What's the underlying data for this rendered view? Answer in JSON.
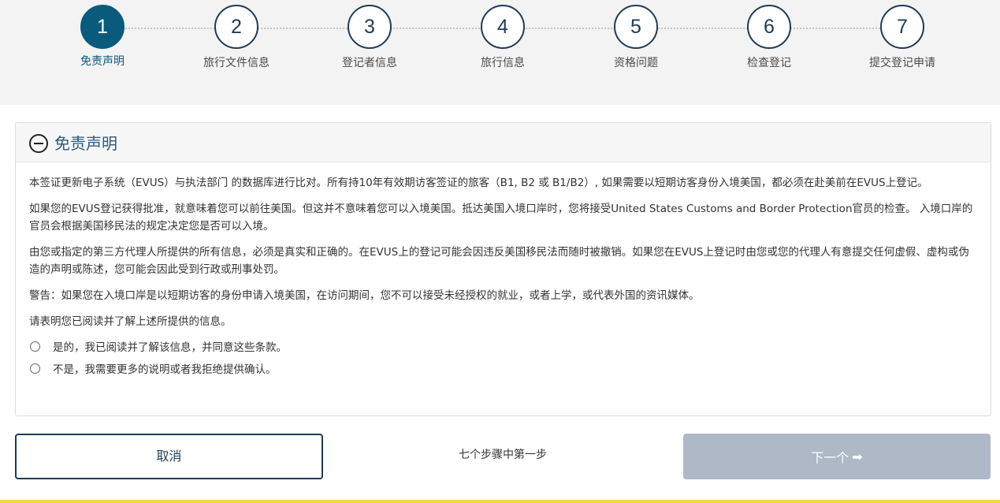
{
  "steps": [
    {
      "number": "1",
      "label": "免责声明",
      "active": true
    },
    {
      "number": "2",
      "label": "旅行文件信息"
    },
    {
      "number": "3",
      "label": "登记者信息"
    },
    {
      "number": "4",
      "label": "旅行信息"
    },
    {
      "number": "5",
      "label": "资格问题"
    },
    {
      "number": "6",
      "label": "检查登记"
    },
    {
      "number": "7",
      "label": "提交登记申请"
    }
  ],
  "panel": {
    "title": "免责声明",
    "paragraphs": [
      "本签证更新电子系统（EVUS）与执法部门 的数据库进行比对。所有持10年有效期访客签证的旅客（B1, B2 或 B1/B2）, 如果需要以短期访客身份入境美国，都必须在赴美前在EVUS上登记。",
      "如果您的EVUS登记获得批准，就意味着您可以前往美国。但这并不意味着您可以入境美国。抵达美国入境口岸时，您将接受United States Customs and Border Protection官员的检查。 入境口岸的官员会根据美国移民法的规定决定您是否可以入境。",
      "由您或指定的第三方代理人所提供的所有信息，必须是真实和正确的。在EVUS上的登记可能会因违反美国移民法而随时被撤销。如果您在EVUS上登记时由您或您的代理人有意提交任何虚假、虚构或伪造的声明或陈述，您可能会因此受到行政或刑事处罚。",
      "警告：如果您在入境口岸是以短期访客的身份申请入境美国，在访问期间，您不可以接受未经授权的就业，或者上学，或代表外国的资讯媒体。",
      "请表明您已阅读并了解上述所提供的信息。"
    ],
    "options": [
      "是的，我已阅读并了解该信息，并同意这些条款。",
      "不是，我需要更多的说明或者我拒绝提供确认。"
    ]
  },
  "footer": {
    "cancel_label": "取消",
    "step_counter": "七个步骤中第一步",
    "next_label": "下一个",
    "next_arrow": "➡"
  },
  "colors": {
    "active_step": "#0a5a7e",
    "step_outline": "#1f3b57",
    "next_disabled": "#aeb8c7",
    "accent_bar": "#f5d640"
  },
  "icons": {
    "collapse": "minus-circle-icon",
    "next": "arrow-right-icon"
  }
}
